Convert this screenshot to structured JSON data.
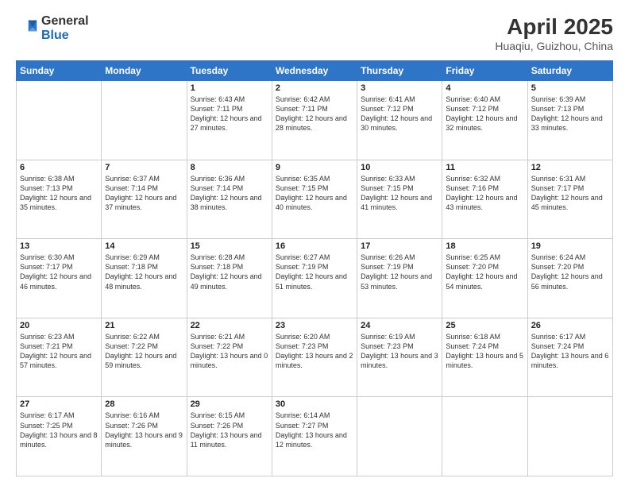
{
  "logo": {
    "general": "General",
    "blue": "Blue"
  },
  "header": {
    "title": "April 2025",
    "location": "Huaqiu, Guizhou, China"
  },
  "weekdays": [
    "Sunday",
    "Monday",
    "Tuesday",
    "Wednesday",
    "Thursday",
    "Friday",
    "Saturday"
  ],
  "weeks": [
    [
      {
        "day": "",
        "content": ""
      },
      {
        "day": "",
        "content": ""
      },
      {
        "day": "1",
        "content": "Sunrise: 6:43 AM\nSunset: 7:11 PM\nDaylight: 12 hours and 27 minutes."
      },
      {
        "day": "2",
        "content": "Sunrise: 6:42 AM\nSunset: 7:11 PM\nDaylight: 12 hours and 28 minutes."
      },
      {
        "day": "3",
        "content": "Sunrise: 6:41 AM\nSunset: 7:12 PM\nDaylight: 12 hours and 30 minutes."
      },
      {
        "day": "4",
        "content": "Sunrise: 6:40 AM\nSunset: 7:12 PM\nDaylight: 12 hours and 32 minutes."
      },
      {
        "day": "5",
        "content": "Sunrise: 6:39 AM\nSunset: 7:13 PM\nDaylight: 12 hours and 33 minutes."
      }
    ],
    [
      {
        "day": "6",
        "content": "Sunrise: 6:38 AM\nSunset: 7:13 PM\nDaylight: 12 hours and 35 minutes."
      },
      {
        "day": "7",
        "content": "Sunrise: 6:37 AM\nSunset: 7:14 PM\nDaylight: 12 hours and 37 minutes."
      },
      {
        "day": "8",
        "content": "Sunrise: 6:36 AM\nSunset: 7:14 PM\nDaylight: 12 hours and 38 minutes."
      },
      {
        "day": "9",
        "content": "Sunrise: 6:35 AM\nSunset: 7:15 PM\nDaylight: 12 hours and 40 minutes."
      },
      {
        "day": "10",
        "content": "Sunrise: 6:33 AM\nSunset: 7:15 PM\nDaylight: 12 hours and 41 minutes."
      },
      {
        "day": "11",
        "content": "Sunrise: 6:32 AM\nSunset: 7:16 PM\nDaylight: 12 hours and 43 minutes."
      },
      {
        "day": "12",
        "content": "Sunrise: 6:31 AM\nSunset: 7:17 PM\nDaylight: 12 hours and 45 minutes."
      }
    ],
    [
      {
        "day": "13",
        "content": "Sunrise: 6:30 AM\nSunset: 7:17 PM\nDaylight: 12 hours and 46 minutes."
      },
      {
        "day": "14",
        "content": "Sunrise: 6:29 AM\nSunset: 7:18 PM\nDaylight: 12 hours and 48 minutes."
      },
      {
        "day": "15",
        "content": "Sunrise: 6:28 AM\nSunset: 7:18 PM\nDaylight: 12 hours and 49 minutes."
      },
      {
        "day": "16",
        "content": "Sunrise: 6:27 AM\nSunset: 7:19 PM\nDaylight: 12 hours and 51 minutes."
      },
      {
        "day": "17",
        "content": "Sunrise: 6:26 AM\nSunset: 7:19 PM\nDaylight: 12 hours and 53 minutes."
      },
      {
        "day": "18",
        "content": "Sunrise: 6:25 AM\nSunset: 7:20 PM\nDaylight: 12 hours and 54 minutes."
      },
      {
        "day": "19",
        "content": "Sunrise: 6:24 AM\nSunset: 7:20 PM\nDaylight: 12 hours and 56 minutes."
      }
    ],
    [
      {
        "day": "20",
        "content": "Sunrise: 6:23 AM\nSunset: 7:21 PM\nDaylight: 12 hours and 57 minutes."
      },
      {
        "day": "21",
        "content": "Sunrise: 6:22 AM\nSunset: 7:22 PM\nDaylight: 12 hours and 59 minutes."
      },
      {
        "day": "22",
        "content": "Sunrise: 6:21 AM\nSunset: 7:22 PM\nDaylight: 13 hours and 0 minutes."
      },
      {
        "day": "23",
        "content": "Sunrise: 6:20 AM\nSunset: 7:23 PM\nDaylight: 13 hours and 2 minutes."
      },
      {
        "day": "24",
        "content": "Sunrise: 6:19 AM\nSunset: 7:23 PM\nDaylight: 13 hours and 3 minutes."
      },
      {
        "day": "25",
        "content": "Sunrise: 6:18 AM\nSunset: 7:24 PM\nDaylight: 13 hours and 5 minutes."
      },
      {
        "day": "26",
        "content": "Sunrise: 6:17 AM\nSunset: 7:24 PM\nDaylight: 13 hours and 6 minutes."
      }
    ],
    [
      {
        "day": "27",
        "content": "Sunrise: 6:17 AM\nSunset: 7:25 PM\nDaylight: 13 hours and 8 minutes."
      },
      {
        "day": "28",
        "content": "Sunrise: 6:16 AM\nSunset: 7:26 PM\nDaylight: 13 hours and 9 minutes."
      },
      {
        "day": "29",
        "content": "Sunrise: 6:15 AM\nSunset: 7:26 PM\nDaylight: 13 hours and 11 minutes."
      },
      {
        "day": "30",
        "content": "Sunrise: 6:14 AM\nSunset: 7:27 PM\nDaylight: 13 hours and 12 minutes."
      },
      {
        "day": "",
        "content": ""
      },
      {
        "day": "",
        "content": ""
      },
      {
        "day": "",
        "content": ""
      }
    ]
  ]
}
